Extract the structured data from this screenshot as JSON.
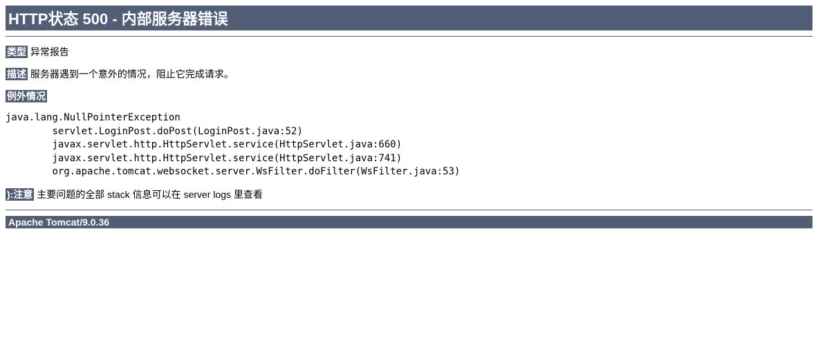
{
  "title": "HTTP状态 500 - 内部服务器错误",
  "type_label": "类型",
  "type_value": "异常报告",
  "desc_label": "描述",
  "desc_value": "服务器遇到一个意外的情况，阻止它完成请求。",
  "exception_label": "例外情况",
  "stack_trace": "java.lang.NullPointerException\n\tservlet.LoginPost.doPost(LoginPost.java:52)\n\tjavax.servlet.http.HttpServlet.service(HttpServlet.java:660)\n\tjavax.servlet.http.HttpServlet.service(HttpServlet.java:741)\n\torg.apache.tomcat.websocket.server.WsFilter.doFilter(WsFilter.java:53)",
  "note_label": "):注意",
  "note_value": "主要问题的全部 stack 信息可以在 server logs 里查看",
  "footer": "Apache Tomcat/9.0.36"
}
